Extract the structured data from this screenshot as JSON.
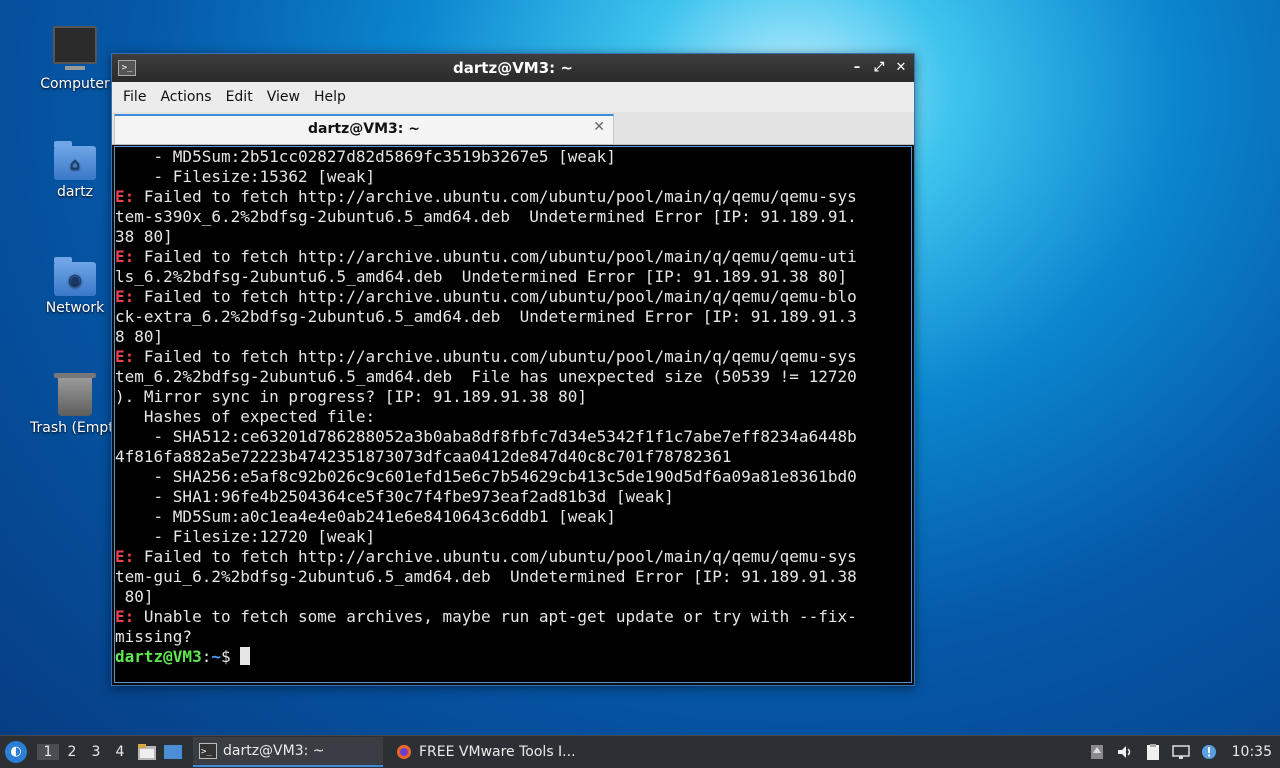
{
  "desktop": {
    "icons": [
      {
        "label": "Computer"
      },
      {
        "label": "dartz"
      },
      {
        "label": "Network"
      },
      {
        "label": "Trash (Empty)"
      }
    ]
  },
  "window": {
    "title": "dartz@VM3: ~",
    "menu": [
      "File",
      "Actions",
      "Edit",
      "View",
      "Help"
    ],
    "tab_label": "dartz@VM3: ~",
    "controls": {
      "minimize": "–",
      "maximize": "⤢",
      "close": "✕"
    }
  },
  "terminal": {
    "lines": [
      {
        "text": "    - MD5Sum:2b51cc02827d82d5869fc3519b3267e5 [weak]"
      },
      {
        "text": "    - Filesize:15362 [weak]"
      },
      {
        "err": "E:",
        "text": " Failed to fetch http://archive.ubuntu.com/ubuntu/pool/main/q/qemu/qemu-sys"
      },
      {
        "text": "tem-s390x_6.2%2bdfsg-2ubuntu6.5_amd64.deb  Undetermined Error [IP: 91.189.91."
      },
      {
        "text": "38 80]"
      },
      {
        "err": "E:",
        "text": " Failed to fetch http://archive.ubuntu.com/ubuntu/pool/main/q/qemu/qemu-uti"
      },
      {
        "text": "ls_6.2%2bdfsg-2ubuntu6.5_amd64.deb  Undetermined Error [IP: 91.189.91.38 80]"
      },
      {
        "err": "E:",
        "text": " Failed to fetch http://archive.ubuntu.com/ubuntu/pool/main/q/qemu/qemu-blo"
      },
      {
        "text": "ck-extra_6.2%2bdfsg-2ubuntu6.5_amd64.deb  Undetermined Error [IP: 91.189.91.3"
      },
      {
        "text": "8 80]"
      },
      {
        "err": "E:",
        "text": " Failed to fetch http://archive.ubuntu.com/ubuntu/pool/main/q/qemu/qemu-sys"
      },
      {
        "text": "tem_6.2%2bdfsg-2ubuntu6.5_amd64.deb  File has unexpected size (50539 != 12720"
      },
      {
        "text": "). Mirror sync in progress? [IP: 91.189.91.38 80]"
      },
      {
        "text": "   Hashes of expected file:"
      },
      {
        "text": "    - SHA512:ce63201d786288052a3b0aba8df8fbfc7d34e5342f1f1c7abe7eff8234a6448b"
      },
      {
        "text": "4f816fa882a5e72223b4742351873073dfcaa0412de847d40c8c701f78782361"
      },
      {
        "text": "    - SHA256:e5af8c92b026c9c601efd15e6c7b54629cb413c5de190d5df6a09a81e8361bd0"
      },
      {
        "text": "    - SHA1:96fe4b2504364ce5f30c7f4fbe973eaf2ad81b3d [weak]"
      },
      {
        "text": "    - MD5Sum:a0c1ea4e4e0ab241e6e8410643c6ddb1 [weak]"
      },
      {
        "text": "    - Filesize:12720 [weak]"
      },
      {
        "err": "E:",
        "text": " Failed to fetch http://archive.ubuntu.com/ubuntu/pool/main/q/qemu/qemu-sys"
      },
      {
        "text": "tem-gui_6.2%2bdfsg-2ubuntu6.5_amd64.deb  Undetermined Error [IP: 91.189.91.38"
      },
      {
        "text": " 80]"
      },
      {
        "err": "E:",
        "text": " Unable to fetch some archives, maybe run apt-get update or try with --fix-"
      },
      {
        "text": "missing?"
      }
    ],
    "prompt": {
      "user": "dartz@VM3",
      "sep": ":",
      "path": "~",
      "symbol": "$ "
    }
  },
  "taskbar": {
    "workspaces": [
      "1",
      "2",
      "3",
      "4"
    ],
    "tasks": [
      {
        "label": "dartz@VM3: ~"
      },
      {
        "label": "FREE VMware Tools I..."
      }
    ],
    "clock": "10:35"
  }
}
